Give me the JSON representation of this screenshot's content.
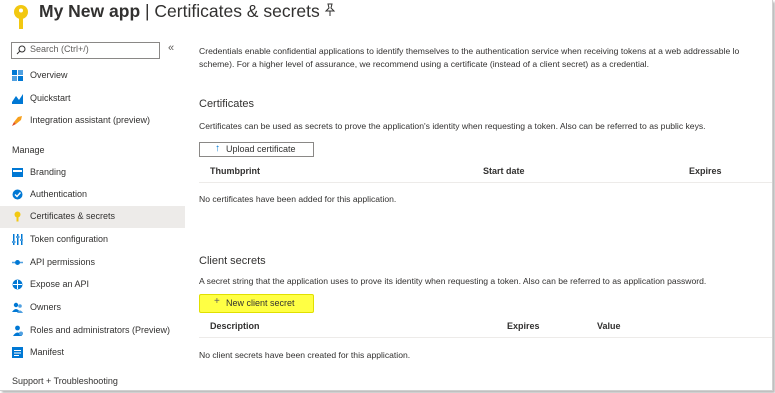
{
  "header": {
    "app_name": "My New app",
    "separator": " | ",
    "page_title": "Certificates & secrets"
  },
  "sidebar": {
    "search_placeholder": "Search (Ctrl+/)",
    "collapse_glyph": "«",
    "items_top": [
      {
        "label": "Overview",
        "icon": "overview-icon"
      },
      {
        "label": "Quickstart",
        "icon": "quickstart-icon"
      },
      {
        "label": "Integration assistant (preview)",
        "icon": "rocket-icon"
      }
    ],
    "manage_label": "Manage",
    "manage_items": [
      {
        "label": "Branding",
        "icon": "branding-icon"
      },
      {
        "label": "Authentication",
        "icon": "authentication-icon"
      },
      {
        "label": "Certificates & secrets",
        "icon": "key-icon",
        "active": true
      },
      {
        "label": "Token configuration",
        "icon": "token-config-icon"
      },
      {
        "label": "API permissions",
        "icon": "api-permissions-icon"
      },
      {
        "label": "Expose an API",
        "icon": "expose-api-icon"
      },
      {
        "label": "Owners",
        "icon": "owners-icon"
      },
      {
        "label": "Roles and administrators (Preview)",
        "icon": "roles-icon"
      },
      {
        "label": "Manifest",
        "icon": "manifest-icon"
      }
    ],
    "support_label": "Support + Troubleshooting"
  },
  "main": {
    "intro_line1": "Credentials enable confidential applications to identify themselves to the authentication service when receiving tokens at a web addressable lo",
    "intro_line2": "scheme). For a higher level of assurance, we recommend using a certificate (instead of a client secret) as a credential.",
    "certificates": {
      "heading": "Certificates",
      "description": "Certificates can be used as secrets to prove the application's identity when requesting a token. Also can be referred to as public keys.",
      "button_label": "Upload certificate",
      "columns": [
        "Thumbprint",
        "Start date",
        "Expires"
      ],
      "empty_text": "No certificates have been added for this application."
    },
    "client_secrets": {
      "heading": "Client secrets",
      "description": "A secret string that the application uses to prove its identity when requesting a token. Also can be referred to as application password.",
      "button_label": "New client secret",
      "columns": [
        "Description",
        "Expires",
        "Value"
      ],
      "empty_text": "No client secrets have been created for this application."
    }
  },
  "colors": {
    "accent": "#0078d4",
    "highlight": "#ffff44",
    "active_nav": "#edebe9",
    "key_icon": "#f2c811"
  }
}
